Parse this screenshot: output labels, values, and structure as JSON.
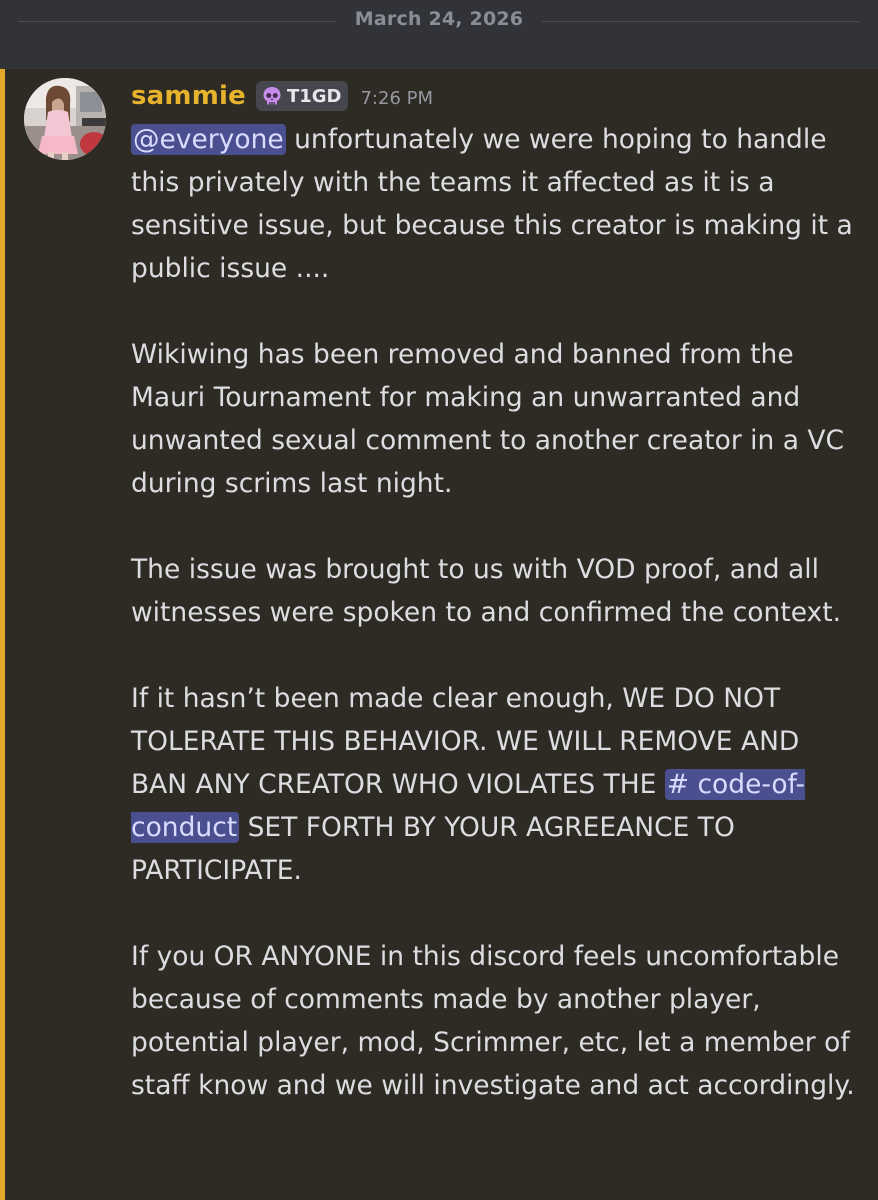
{
  "date_divider": {
    "label": "March 24, 2026"
  },
  "message": {
    "author": "sammie",
    "tag": {
      "icon": "skull-icon",
      "text": "T1GD"
    },
    "timestamp": "7:26 PM",
    "colors": {
      "highlight_bar": "#e4a92c",
      "username": "#e8b32c",
      "mention_bg": "#4a4f8f"
    },
    "paragraphs": {
      "p1": {
        "mention": "@everyone",
        "text": " unfortunately we were hoping to handle this privately with the teams it affected as it is a sensitive issue, but because this creator is making it a public issue ...."
      },
      "p2": "Wikiwing has been removed and banned from the Mauri Tournament for making an unwarranted and unwanted sexual comment to another creator in a VC during scrims last night.",
      "p3": "The issue was brought to us with VOD proof, and all witnesses were spoken to and confirmed the context.",
      "p4": {
        "before": "If it hasn’t been made clear enough, WE DO NOT TOLERATE THIS BEHAVIOR. WE WILL REMOVE AND BAN ANY CREATOR WHO VIOLATES THE ",
        "channel": "# code-of-conduct",
        "after": " SET FORTH BY YOUR AGREEANCE TO PARTICIPATE."
      },
      "p5": "If you OR ANYONE in this discord feels uncomfortable because of comments made by another player, potential player, mod, Scrimmer, etc, let a member of staff know and we will investigate and act accordingly."
    }
  }
}
